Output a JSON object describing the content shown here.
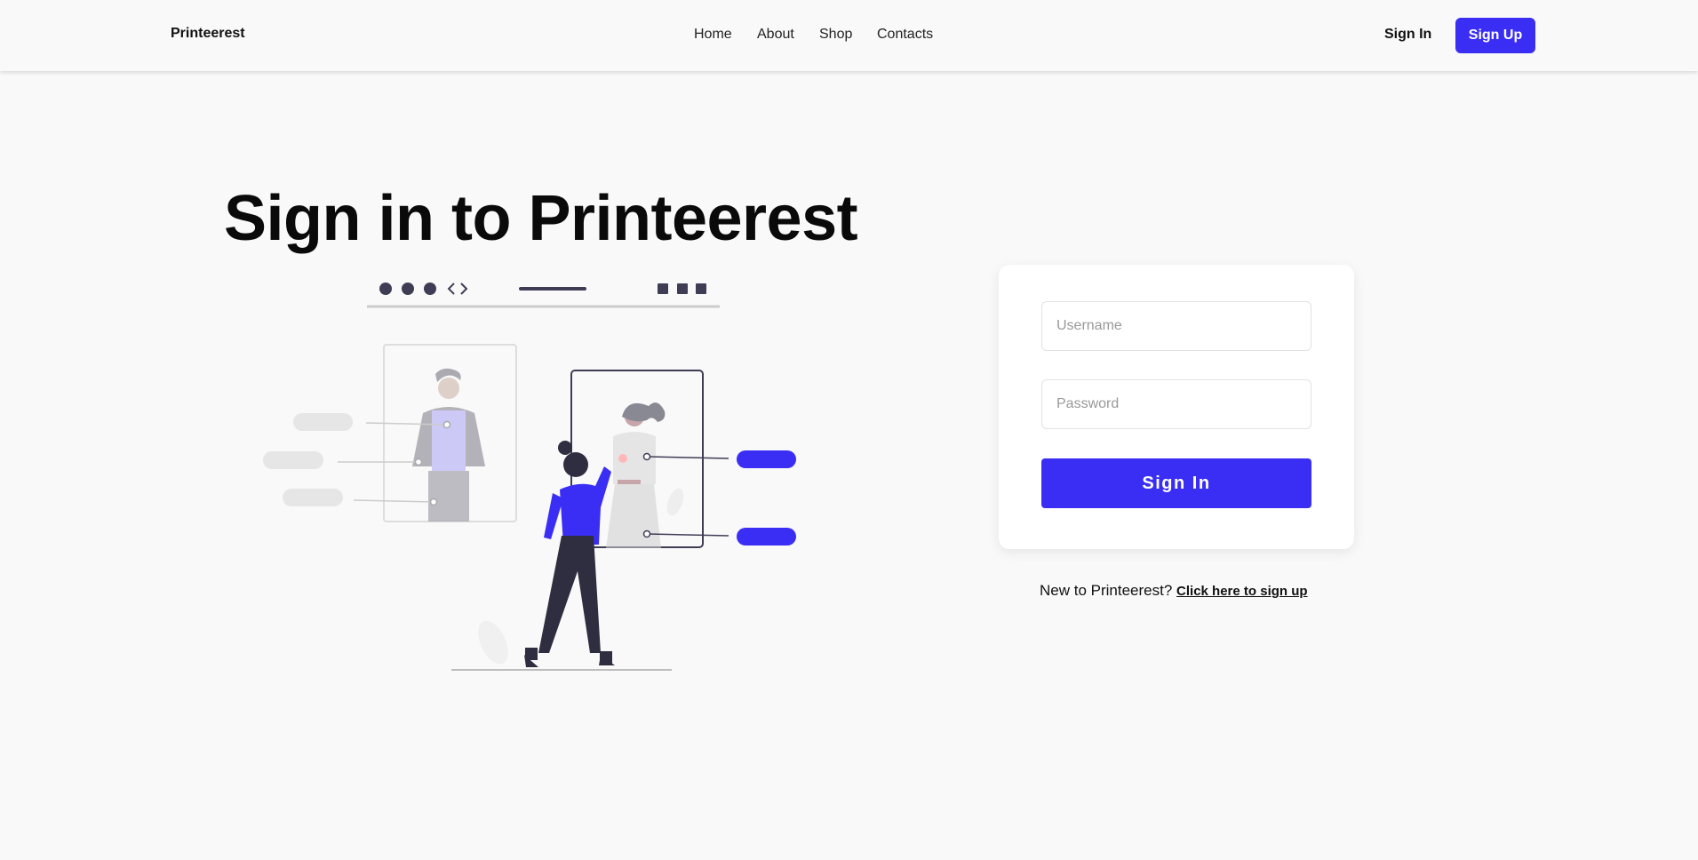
{
  "nav": {
    "brand": "Printeerest",
    "links": [
      {
        "label": "Home"
      },
      {
        "label": "About"
      },
      {
        "label": "Shop"
      },
      {
        "label": "Contacts"
      }
    ],
    "sign_in": "Sign In",
    "sign_up": "Sign Up"
  },
  "hero": {
    "title": "Sign in to Printeerest"
  },
  "form": {
    "username_placeholder": "Username",
    "username_value": "",
    "password_placeholder": "Password",
    "password_value": "",
    "submit_label": "Sign In"
  },
  "signup_prompt": {
    "text": "New to Printeerest?",
    "link_label": "Click here to sign up"
  },
  "colors": {
    "accent": "#3a2ef5",
    "background": "#f9f9f9",
    "illustration_dark": "#3f3d56",
    "illustration_light_purple": "#a9a2f7",
    "illustration_gray": "#e6e6e6"
  },
  "illustration": {
    "icons": [
      "browser-dots-icon",
      "code-brackets-icon",
      "window-squares-icon"
    ]
  }
}
